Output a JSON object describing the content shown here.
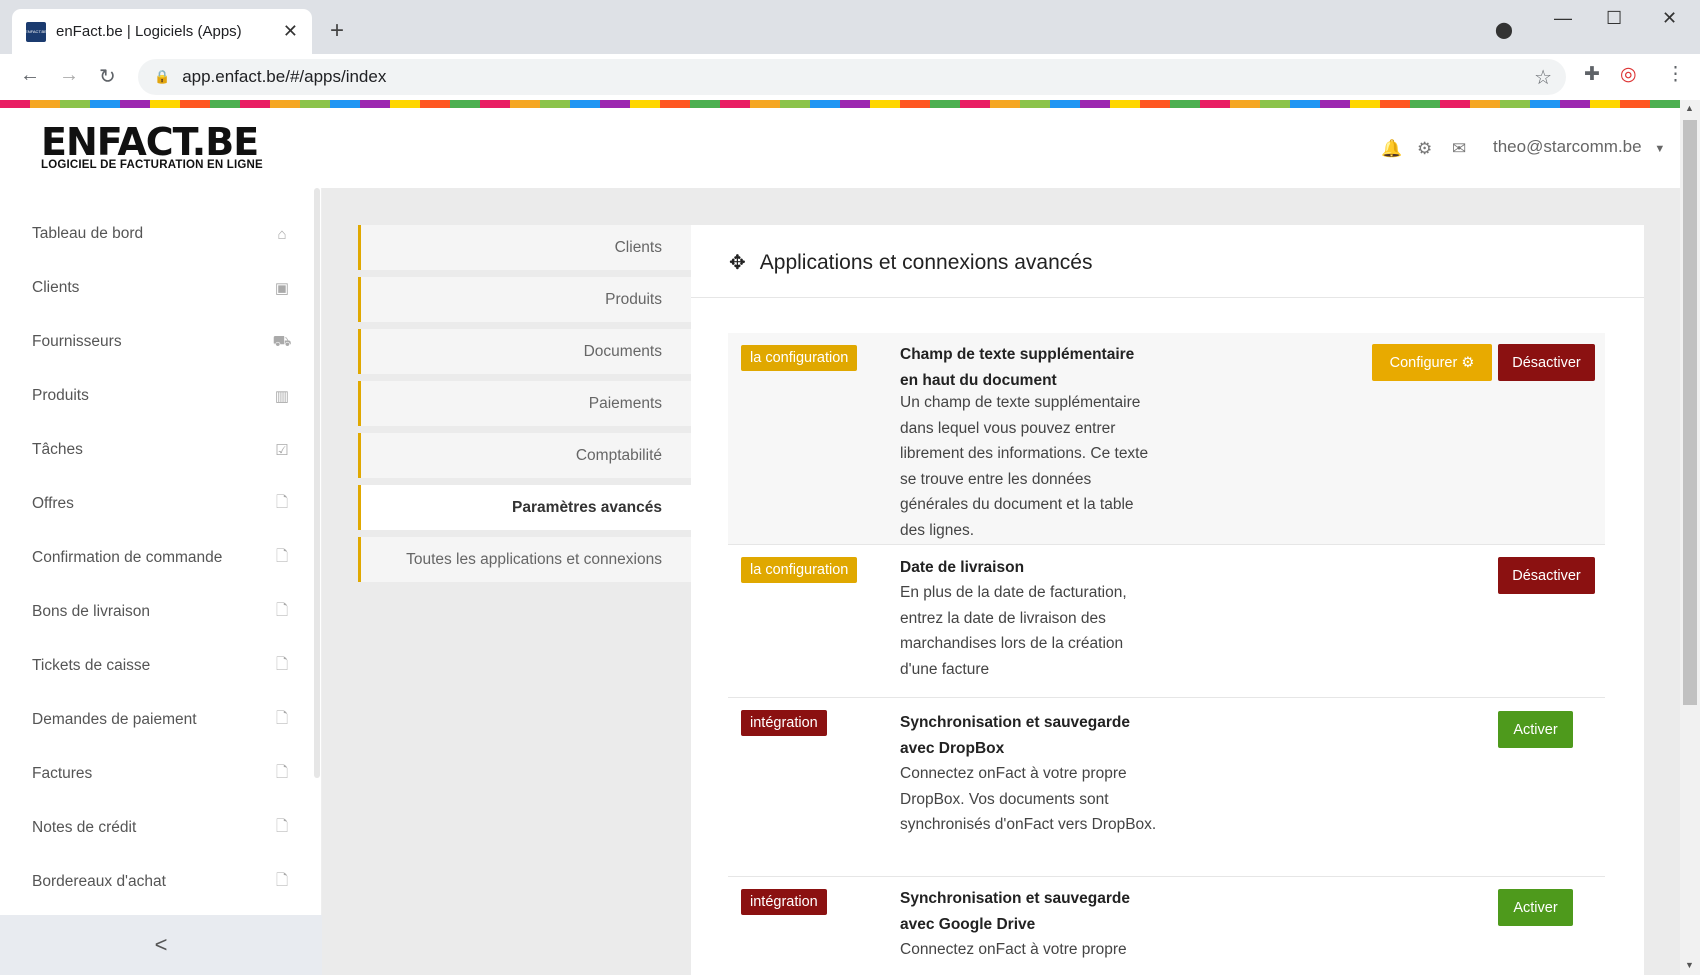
{
  "browser": {
    "tab_title": "enFact.be | Logiciels (Apps)",
    "favicon_text": "ENFACT.BE",
    "url": "app.enfact.be/#/apps/index"
  },
  "header": {
    "logo_main": "ENFACT.BE",
    "logo_sub": "LOGICIEL DE FACTURATION EN LIGNE",
    "user_email": "theo@starcomm.be"
  },
  "sidebar": {
    "items": [
      {
        "label": "Tableau de bord",
        "icon": "home-icon"
      },
      {
        "label": "Clients",
        "icon": "address-book-icon"
      },
      {
        "label": "Fournisseurs",
        "icon": "truck-icon"
      },
      {
        "label": "Produits",
        "icon": "barcode-icon"
      },
      {
        "label": "Tâches",
        "icon": "clipboard-check-icon"
      },
      {
        "label": "Offres",
        "icon": "pdf-file-icon"
      },
      {
        "label": "Confirmation de commande",
        "icon": "pdf-file-icon"
      },
      {
        "label": "Bons de livraison",
        "icon": "pdf-file-icon"
      },
      {
        "label": "Tickets de caisse",
        "icon": "pdf-file-icon"
      },
      {
        "label": "Demandes de paiement",
        "icon": "pdf-file-icon"
      },
      {
        "label": "Factures",
        "icon": "pdf-file-icon"
      },
      {
        "label": "Notes de crédit",
        "icon": "pdf-file-icon"
      },
      {
        "label": "Bordereaux d'achat",
        "icon": "pdf-file-icon"
      }
    ],
    "collapse_label": "<"
  },
  "subnav": {
    "items": [
      "Clients",
      "Produits",
      "Documents",
      "Paiements",
      "Comptabilité",
      "Paramètres avancés",
      "Toutes les applications et connexions"
    ],
    "active": "Paramètres avancés"
  },
  "panel": {
    "title": "Applications et connexions avancés",
    "apps": [
      {
        "badge": "la configuration",
        "title": "Champ de texte supplémentaire en haut du document",
        "description": "Un champ de texte supplémentaire dans lequel vous pouvez entrer librement des informations. Ce texte se trouve entre les données générales du document et la table des lignes.",
        "buttons": [
          "Configurer ⚙",
          "Désactiver"
        ]
      },
      {
        "badge": "la configuration",
        "title": "Date de livraison",
        "description": "En plus de la date de facturation, entrez la date de livraison des marchandises lors de la création d'une facture",
        "buttons": [
          "Désactiver"
        ]
      },
      {
        "badge": "intégration",
        "title": "Synchronisation et sauvegarde avec DropBox",
        "description": "Connectez onFact à votre propre DropBox. Vos documents sont synchronisés d'onFact vers DropBox.",
        "buttons": [
          "Activer"
        ]
      },
      {
        "badge": "intégration",
        "title": "Synchronisation et sauvegarde avec Google Drive",
        "description": "Connectez onFact à votre propre",
        "buttons": [
          "Activer"
        ]
      }
    ]
  }
}
